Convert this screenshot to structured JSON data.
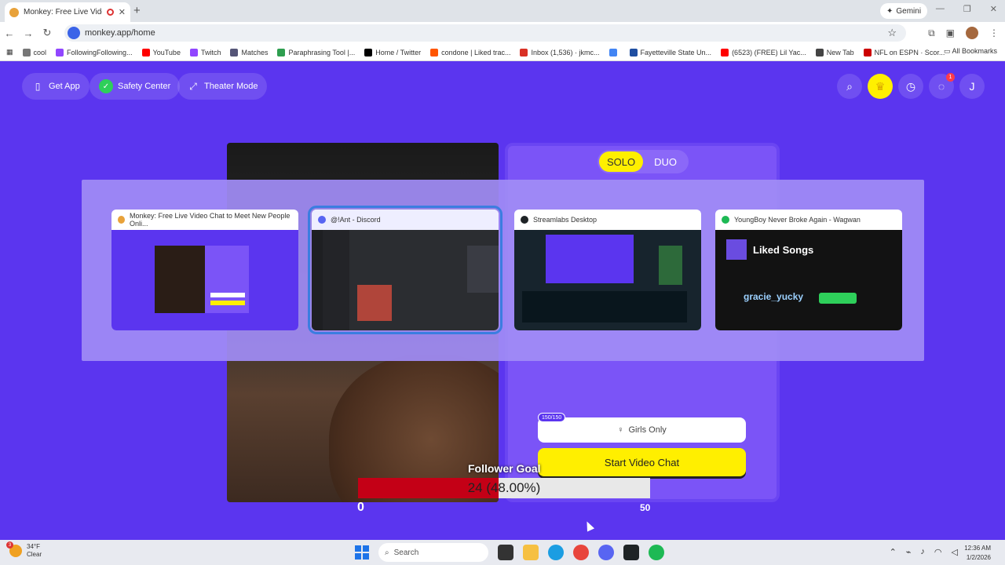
{
  "browser": {
    "tab_title": "Monkey: Free Live Video Chat to Meet New People Online",
    "new_tab_symbol": "+",
    "close_symbol": "✕",
    "gemini_label": "Gemini",
    "url": "monkey.app/home",
    "bookmarks": [
      {
        "label": "cool",
        "color": "#777777"
      },
      {
        "label": "FollowingFollowing...",
        "color": "#9146ff"
      },
      {
        "label": "YouTube",
        "color": "#ff0000"
      },
      {
        "label": "Twitch",
        "color": "#9146ff"
      },
      {
        "label": "Matches",
        "color": "#555577"
      },
      {
        "label": "Paraphrasing Tool |...",
        "color": "#2e9e4f"
      },
      {
        "label": "Home / Twitter",
        "color": "#000000"
      },
      {
        "label": "condone | Liked trac...",
        "color": "#ff5500"
      },
      {
        "label": "Inbox (1,536) · jkmc...",
        "color": "#d93025"
      },
      {
        "label": "",
        "color": "#4285f4"
      },
      {
        "label": "Fayetteville State Un...",
        "color": "#1f4ea1"
      },
      {
        "label": "(6523) (FREE) Lil Yac...",
        "color": "#ff0000"
      },
      {
        "label": "New Tab",
        "color": "#444444"
      },
      {
        "label": "NFL on ESPN · Scor...",
        "color": "#cc0000"
      }
    ],
    "all_bookmarks": "All Bookmarks"
  },
  "page": {
    "get_app": "Get App",
    "safety_center": "Safety Center",
    "theater_mode": "Theater Mode",
    "messages_badge": "1",
    "avatar_initial": "J",
    "modes": [
      "SOLO",
      "DUO"
    ],
    "active_mode": "SOLO",
    "upgrades_count": "150/150",
    "girls_only": "Girls Only",
    "start_video_chat": "Start Video Chat",
    "follower_goal": {
      "label": "Follower Goal",
      "current": 24,
      "percent": 48.0,
      "text": "24 (48.00%)",
      "min": "0",
      "max": "50"
    }
  },
  "task_switcher": {
    "windows": [
      {
        "title": "Monkey: Free Live Video Chat to Meet New People Onli...",
        "icon_color": "#e8a23a",
        "selected": false
      },
      {
        "title": "@!Ant - Discord",
        "icon_color": "#5865f2",
        "selected": true
      },
      {
        "title": "Streamlabs Desktop",
        "icon_color": "#1e2326",
        "selected": false
      },
      {
        "title": "YoungBoy Never Broke Again - Wagwan",
        "icon_color": "#1db954",
        "selected": false
      }
    ],
    "spotify_heading": "Liked Songs",
    "spotify_overlay_name": "gracie_yucky"
  },
  "taskbar": {
    "weather_temp": "34°F",
    "weather_cond": "Clear",
    "weather_badge": "3",
    "search_label": "Search",
    "time": "12:36 AM",
    "date": "1/2/2026"
  }
}
